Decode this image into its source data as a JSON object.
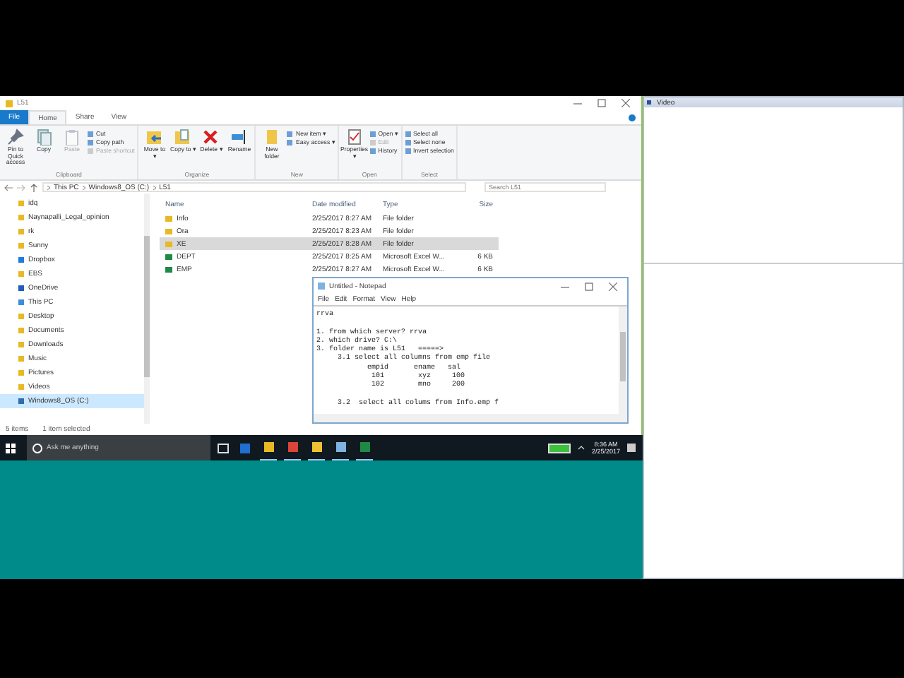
{
  "explorer": {
    "title": "L51",
    "file_tab": "File",
    "tabs": [
      {
        "label": "Home",
        "selected": true
      },
      {
        "label": "Share",
        "selected": false
      },
      {
        "label": "View",
        "selected": false
      }
    ],
    "ribbon": [
      {
        "label": "Clipboard",
        "large": [
          {
            "label": "Pin to Quick access",
            "disabled": false
          },
          {
            "label": "Copy",
            "disabled": false
          },
          {
            "label": "Paste",
            "disabled": true
          }
        ],
        "small": [
          {
            "label": "Cut",
            "disabled": false
          },
          {
            "label": "Copy path",
            "disabled": false
          },
          {
            "label": "Paste shortcut",
            "disabled": true
          }
        ]
      },
      {
        "label": "Organize",
        "large": [
          {
            "label": "Move to ▾",
            "disabled": false
          },
          {
            "label": "Copy to ▾",
            "disabled": false
          },
          {
            "label": "Delete ▾",
            "disabled": false
          },
          {
            "label": "Rename",
            "disabled": false
          }
        ]
      },
      {
        "label": "New",
        "large": [
          {
            "label": "New folder",
            "disabled": false
          }
        ],
        "small": [
          {
            "label": "New item ▾",
            "disabled": false
          },
          {
            "label": "Easy access ▾",
            "disabled": false
          }
        ]
      },
      {
        "label": "Open",
        "large": [
          {
            "label": "Properties ▾",
            "disabled": false
          }
        ],
        "small": [
          {
            "label": "Open ▾",
            "disabled": false
          },
          {
            "label": "Edit",
            "disabled": true
          },
          {
            "label": "History",
            "disabled": false
          }
        ]
      },
      {
        "label": "Select",
        "small": [
          {
            "label": "Select all",
            "disabled": false
          },
          {
            "label": "Select none",
            "disabled": false
          },
          {
            "label": "Invert selection",
            "disabled": false
          }
        ]
      }
    ],
    "path": [
      "This PC",
      "Windows8_OS (C:)",
      "L51"
    ],
    "search": {
      "placeholder": "Search L51"
    },
    "nav": [
      {
        "label": "idq",
        "kind": "folder",
        "selected": false
      },
      {
        "label": "Naynapalli_Legal_opinion",
        "kind": "folder",
        "selected": false
      },
      {
        "label": "rk",
        "kind": "folder",
        "selected": false
      },
      {
        "label": "Sunny",
        "kind": "folder",
        "selected": false
      },
      {
        "label": "Dropbox",
        "kind": "dropbox",
        "selected": false,
        "children": [
          {
            "label": "EBS",
            "kind": "folder",
            "selected": false
          }
        ]
      },
      {
        "label": "OneDrive",
        "kind": "cloud",
        "selected": false
      },
      {
        "label": "This PC",
        "kind": "pc",
        "selected": false,
        "children": [
          {
            "label": "Desktop",
            "kind": "folder",
            "selected": false
          },
          {
            "label": "Documents",
            "kind": "folder",
            "selected": false
          },
          {
            "label": "Downloads",
            "kind": "folder",
            "selected": false
          },
          {
            "label": "Music",
            "kind": "folder",
            "selected": false
          },
          {
            "label": "Pictures",
            "kind": "folder",
            "selected": false
          },
          {
            "label": "Videos",
            "kind": "folder",
            "selected": false
          },
          {
            "label": "Windows8_OS (C:)",
            "kind": "drive",
            "selected": true
          }
        ]
      }
    ],
    "columns": [
      "Name",
      "Date modified",
      "Type",
      "Size"
    ],
    "rows": [
      {
        "name": "Info",
        "date": "2/25/2017 8:27 AM",
        "type": "File folder",
        "size": "",
        "kind": "folder",
        "selected": false
      },
      {
        "name": "Ora",
        "date": "2/25/2017 8:23 AM",
        "type": "File folder",
        "size": "",
        "kind": "folder",
        "selected": false
      },
      {
        "name": "XE",
        "date": "2/25/2017 8:28 AM",
        "type": "File folder",
        "size": "",
        "kind": "folder",
        "selected": true
      },
      {
        "name": "DEPT",
        "date": "2/25/2017 8:25 AM",
        "type": "Microsoft Excel W...",
        "size": "6 KB",
        "kind": "excel",
        "selected": false
      },
      {
        "name": "EMP",
        "date": "2/25/2017 8:27 AM",
        "type": "Microsoft Excel W...",
        "size": "6 KB",
        "kind": "excel",
        "selected": false
      }
    ],
    "status": [
      "5 items",
      "1 item selected"
    ]
  },
  "notepad": {
    "title": "Untitled - Notepad",
    "menu": [
      "File",
      "Edit",
      "Format",
      "View",
      "Help"
    ],
    "paragraphs": [
      [
        "rrva"
      ],
      [
        "1. from which server? rrva",
        "2. which drive? C:\\",
        "3. folder name is L51   =====>",
        "     3.1 select all columns from emp file",
        "            empid      ename   sal",
        "             101        xyz     100",
        "             102        mno     200"
      ],
      [
        "     3.2  select all colums from Info.emp f"
      ]
    ]
  },
  "taskbar": {
    "search_placeholder": "Ask me anything",
    "time": "8:36 AM",
    "date": "2/25/2017",
    "apps": [
      {
        "kind": "edge",
        "open": false
      },
      {
        "kind": "explorer",
        "open": true
      },
      {
        "kind": "chrome",
        "open": true
      },
      {
        "kind": "app",
        "open": true
      },
      {
        "kind": "notepad",
        "open": true
      },
      {
        "kind": "excel",
        "open": true
      }
    ]
  },
  "video_panel": {
    "title": "Video"
  }
}
